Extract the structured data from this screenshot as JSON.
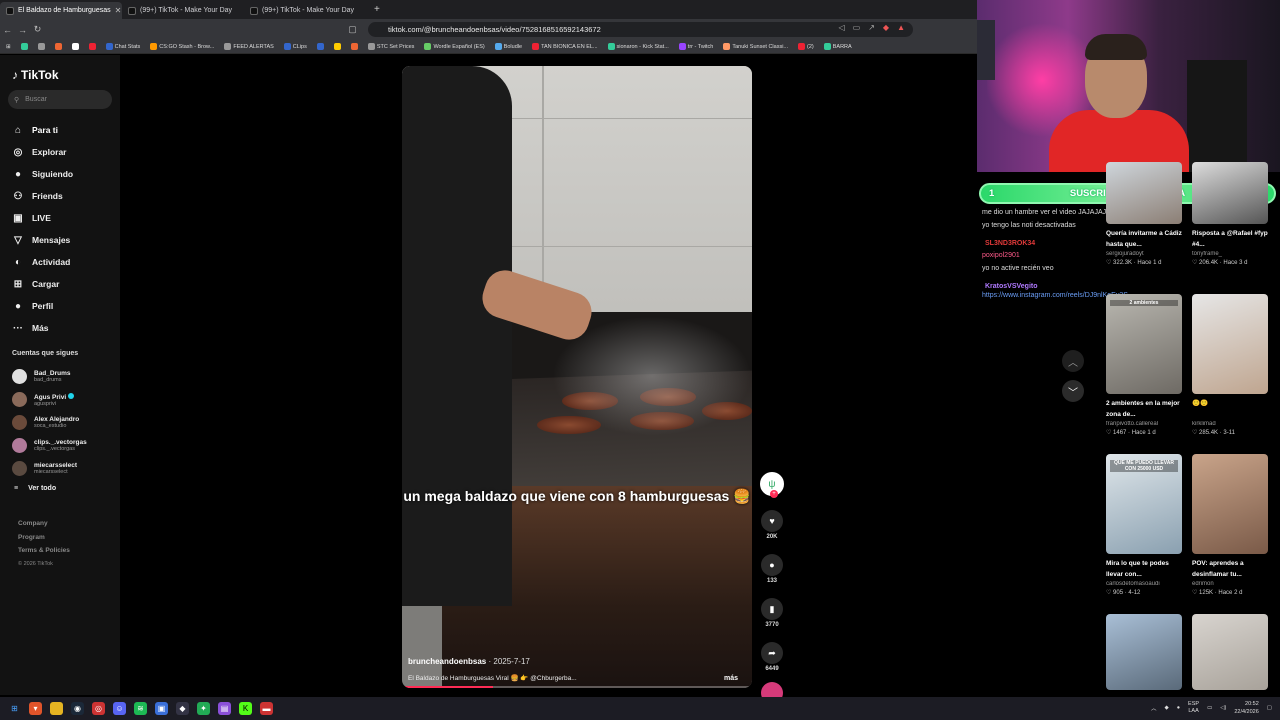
{
  "browser": {
    "tabs": [
      {
        "title": "El Baldazo de Hamburguesas"
      },
      {
        "title": "(99+) TikTok - Make Your Day"
      },
      {
        "title": "(99+) TikTok - Make Your Day"
      }
    ],
    "new_tab": "+",
    "url": "tiktok.com/@bruncheandoenbsas/video/7528168516592143672",
    "bookmarks": [
      "Chat Stats",
      "CS:GO Stash - Brow...",
      "FEED ALERTAS",
      "CLips",
      "STC Set Prices",
      "Wordle Español (ES)",
      "Boludle",
      "TAN BIONICA EN EL...",
      "sionaron - Kick Stat...",
      "trr - Twitch",
      "Tanuki Sunset Classi...",
      "(2)",
      "BARRA"
    ]
  },
  "tiktok": {
    "logo": "TikTok",
    "search_placeholder": "Buscar",
    "nav": [
      {
        "label": "Para ti",
        "icon": "home-icon",
        "glyph": "⌂"
      },
      {
        "label": "Explorar",
        "icon": "compass-icon",
        "glyph": "◎"
      },
      {
        "label": "Siguiendo",
        "icon": "following-icon",
        "glyph": "●"
      },
      {
        "label": "Friends",
        "icon": "friends-icon",
        "glyph": "⚇"
      },
      {
        "label": "LIVE",
        "icon": "live-icon",
        "glyph": "▣"
      },
      {
        "label": "Mensajes",
        "icon": "messages-icon",
        "glyph": "▽",
        "badge": "39"
      },
      {
        "label": "Actividad",
        "icon": "activity-icon",
        "glyph": "◐",
        "badge": "99+"
      },
      {
        "label": "Cargar",
        "icon": "upload-icon",
        "glyph": "⊞"
      },
      {
        "label": "Perfil",
        "icon": "profile-icon",
        "glyph": "●"
      },
      {
        "label": "Más",
        "icon": "more-icon",
        "glyph": "···"
      }
    ],
    "following_title": "Cuentas que sigues",
    "following": [
      {
        "name": "Bad_Drums",
        "user": "bad_drums",
        "color": "#e0e0e0"
      },
      {
        "name": "Agus Privi",
        "user": "agusprivi",
        "verified": true,
        "color": "#8a6a5a"
      },
      {
        "name": "Alex Alejandro",
        "user": "soca_estudio",
        "color": "#6a4a3a"
      },
      {
        "name": "clips._.vectorgas",
        "user": "clips._.vectorgas",
        "color": "#b07a9a"
      },
      {
        "name": "miecarsselect",
        "user": "miecarsselect",
        "color": "#5a4a40"
      }
    ],
    "see_all": "Ver todo",
    "footer": [
      "Company",
      "Program",
      "Terms & Policies"
    ],
    "copyright": "© 2026 TikTok"
  },
  "video": {
    "caption": "un mega baldazo que viene con 8 hamburguesas 🍔",
    "author": "bruncheandoenbsas",
    "date": "· 2025-7-17",
    "description": "El Baldazo de Hamburguesas Viral 🍔 👉 @Chburgerba...",
    "more": "más",
    "progress": 0.26,
    "actions": {
      "likes": "20K",
      "comments": "133",
      "saves": "3770",
      "shares": "6449"
    }
  },
  "stream": {
    "sub_bar": {
      "left": "1",
      "title": "SUSCRIPTORES DEL DIA",
      "right": "1"
    },
    "chat": [
      {
        "type": "msg",
        "text": "me dio un hambre ver el video JAJAJAJ"
      },
      {
        "type": "msg",
        "text": "yo tengo las noti desactivadas"
      },
      {
        "type": "user",
        "text": "SL3ND3ROK34",
        "color": "#e23a3a"
      },
      {
        "type": "msg",
        "text": "poxipol2901",
        "color": "#ff5a8a"
      },
      {
        "type": "msg",
        "text": "yo no active recién veo"
      },
      {
        "type": "user",
        "text": "KratosVSVegito",
        "color": "#b07aff"
      },
      {
        "type": "link",
        "text": "https://www.instagram.com/reels/DJ9nlKoEy3S"
      }
    ]
  },
  "recommendations": [
    {
      "title": "Quería invitarme a Cádiz hasta que...",
      "user": "sergiojuradoyt",
      "meta": "♡ 322.3K · Hace 1 d",
      "colors": [
        "#cfd6dc",
        "#8b7e74"
      ]
    },
    {
      "title": "Risposta a @Rafael #fyp #4...",
      "user": "tonyframe_",
      "meta": "♡ 206.4K · Hace 3 d",
      "colors": [
        "#ddd",
        "#555"
      ]
    },
    {
      "title": "2 ambientes en la mejor zona de...",
      "user": "franpivotto.callereal",
      "meta": "♡ 1467 · Hace 1 d",
      "overlay": "2 ambientes",
      "colors": [
        "#b9b7b0",
        "#6e6a64"
      ]
    },
    {
      "title": "🙂🙂",
      "user": "kirklimad",
      "meta": "♡ 285.4K · 3-11",
      "colors": [
        "#e6e6e6",
        "#bfa58f"
      ]
    },
    {
      "title": "Mira lo que te podes llevar con...",
      "user": "carlosdetomasoaudi",
      "meta": "♡ 905 · 4-12",
      "overlay": "QUE ME PUEDO LLEVAR CON 25000 USD",
      "colors": [
        "#dfe6ea",
        "#8aa0b0"
      ]
    },
    {
      "title": "POV: aprendes a desinflamar tu...",
      "user": "edrimon",
      "meta": "♡ 125K · Hace 2 d",
      "colors": [
        "#c9a48a",
        "#7a5a48"
      ]
    },
    {
      "title": "",
      "user": "",
      "meta": "",
      "colors": [
        "#a9bfd6",
        "#5a6a7a"
      ]
    },
    {
      "title": "",
      "user": "",
      "meta": "",
      "colors": [
        "#d8d4cf",
        "#a8a29a"
      ]
    }
  ],
  "taskbar": {
    "lang": [
      "ESP",
      "LAA"
    ],
    "time": "20:52",
    "date": "22/4/2026"
  }
}
